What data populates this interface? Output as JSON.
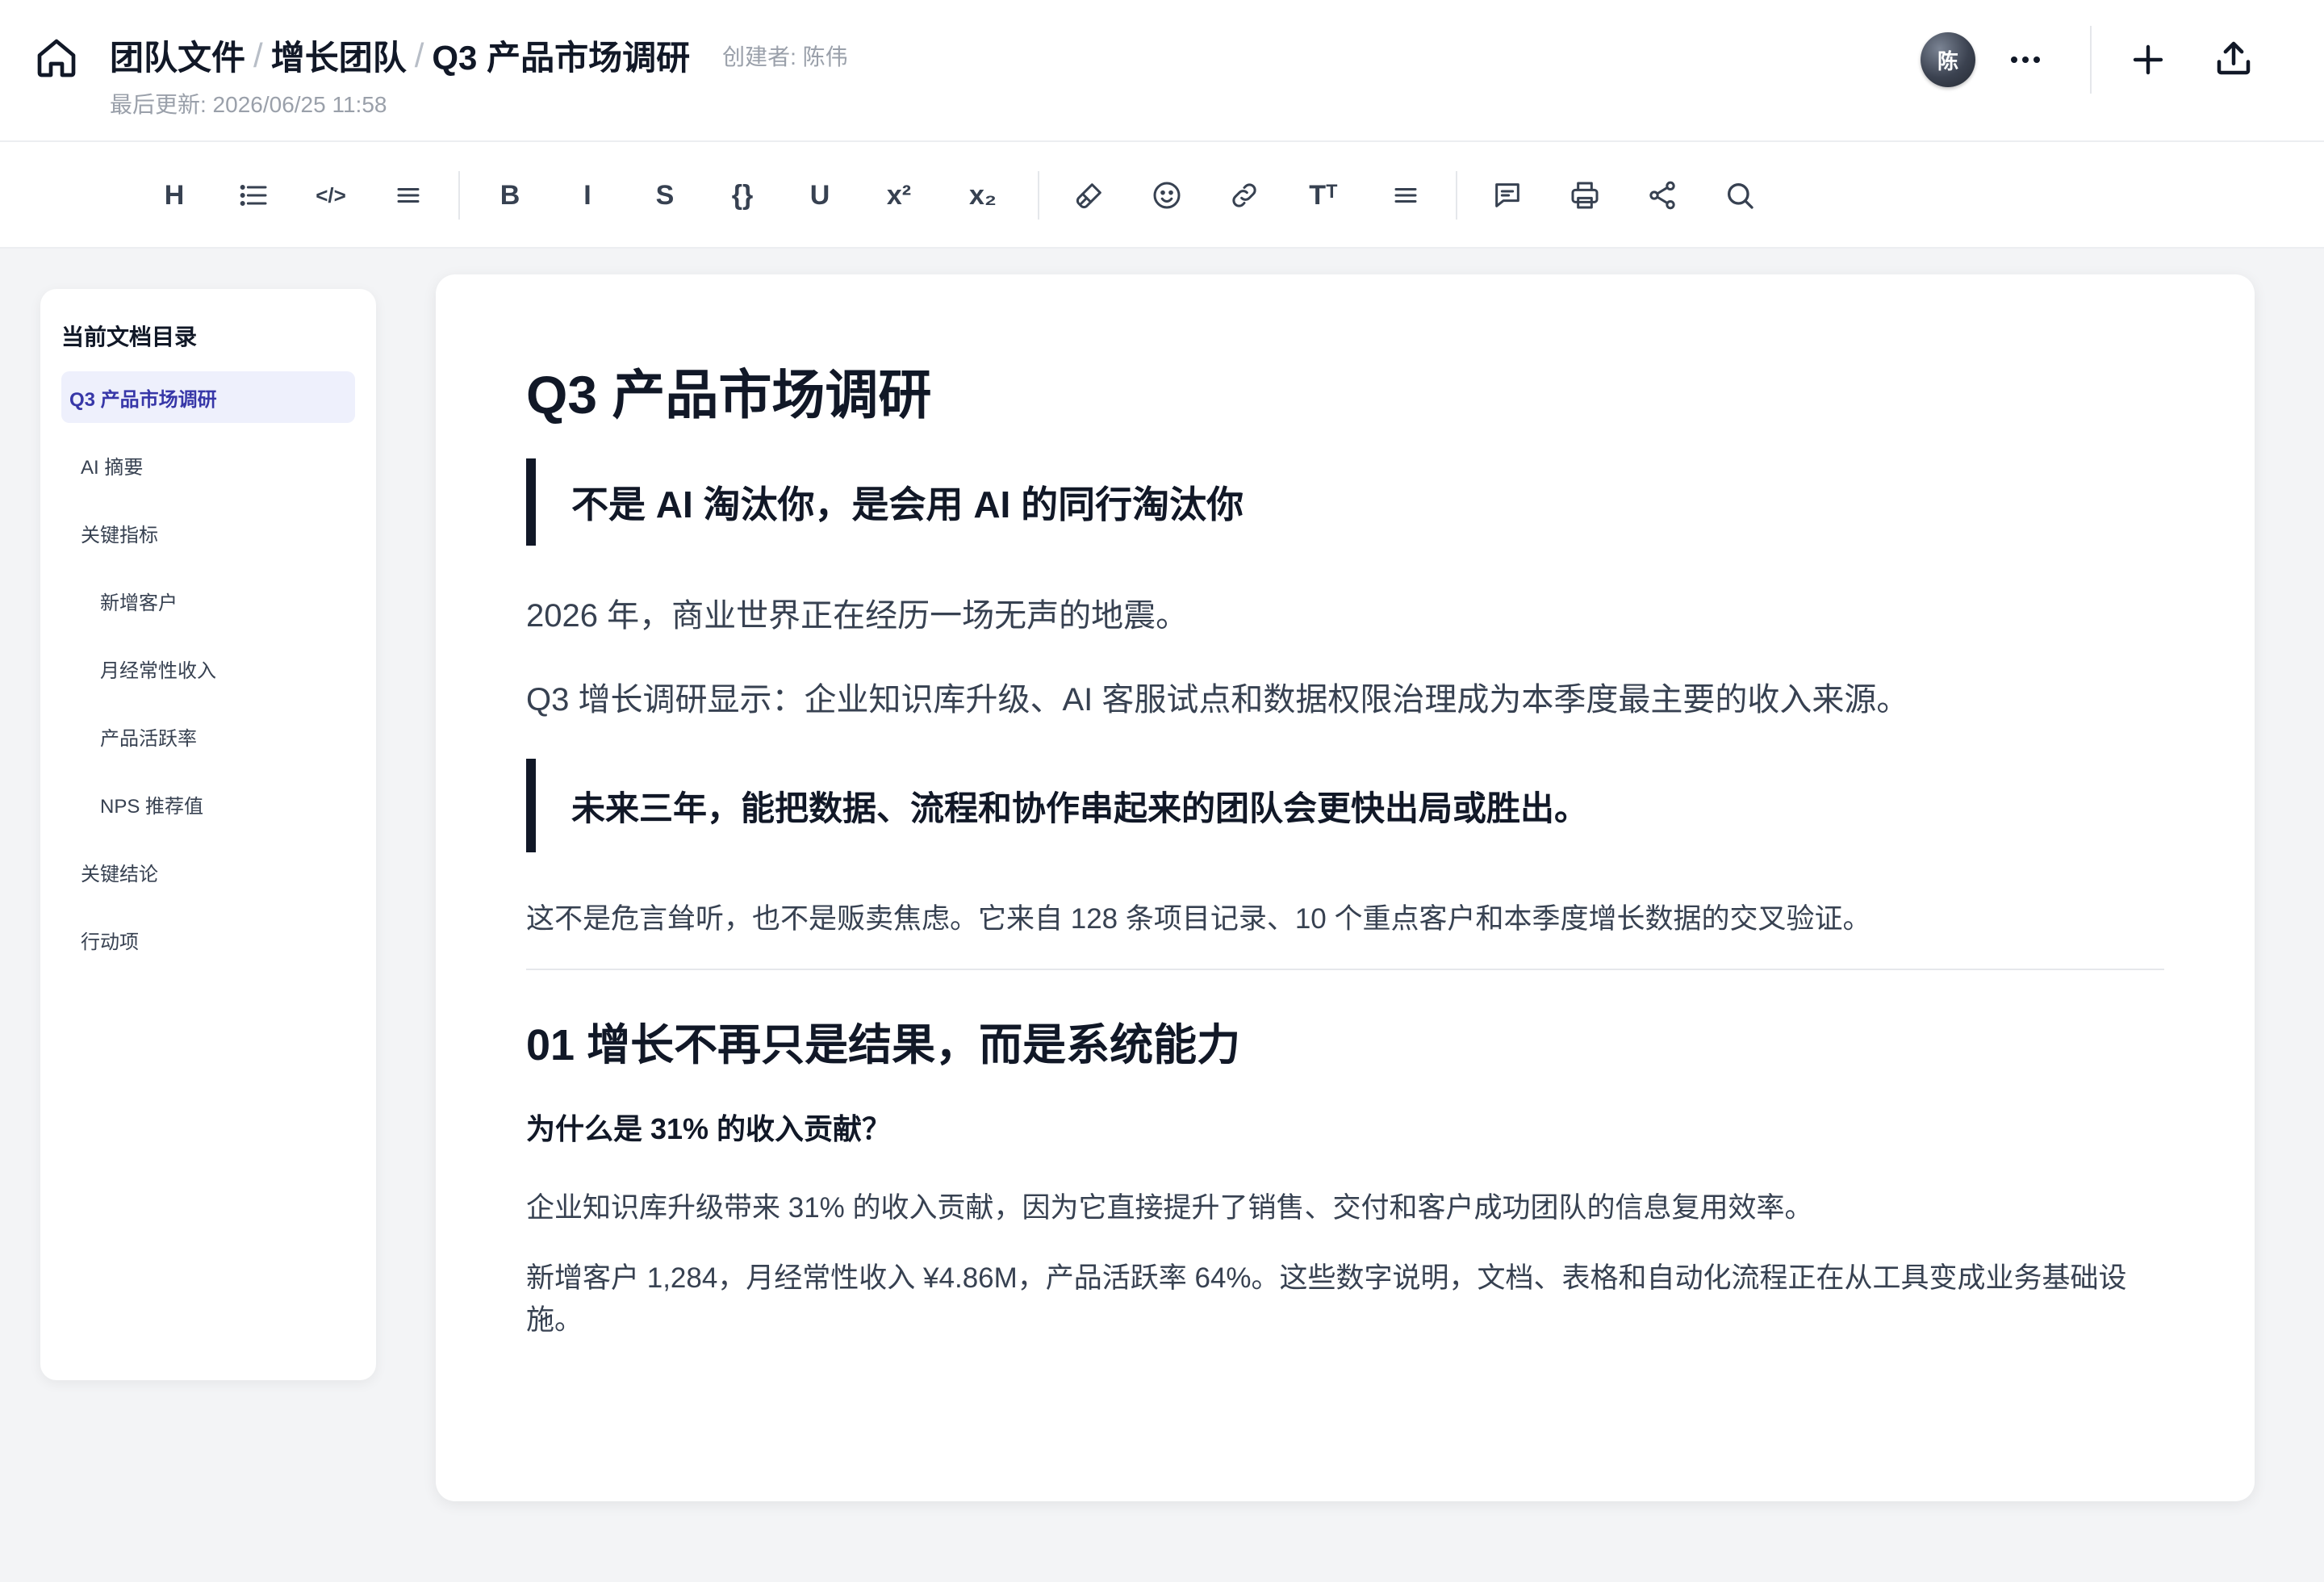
{
  "header": {
    "breadcrumb": [
      "团队文件",
      "增长团队",
      "Q3 产品市场调研"
    ],
    "separator": "/",
    "creator": "创建者: 陈伟",
    "last_updated": "最后更新: 2026/06/25 11:58",
    "avatar_initial": "陈",
    "icons": [
      "home-icon",
      "more-icon",
      "plus-icon",
      "upload-icon"
    ]
  },
  "toolbar": {
    "heading": "H",
    "code": "</>",
    "bold": "B",
    "italic": "I",
    "strike": "S",
    "braces": "{}",
    "underline": "U",
    "superscript": "x²",
    "subscript": "x₂",
    "text_size": "Tᵀ",
    "icons": [
      "heading-icon",
      "bullet-list-icon",
      "code-icon",
      "align-icon",
      "bold-icon",
      "italic-icon",
      "strikethrough-icon",
      "code-block-icon",
      "underline-icon",
      "superscript-icon",
      "subscript-icon",
      "format-painter-icon",
      "emoji-icon",
      "link-icon",
      "text-size-icon",
      "more-align-icon",
      "comment-icon",
      "print-icon",
      "share-icon",
      "search-icon"
    ]
  },
  "sidebar": {
    "title": "当前文档目录",
    "items": [
      {
        "label": "Q3 产品市场调研",
        "level": 0,
        "active": true
      },
      {
        "label": "AI 摘要",
        "level": 1
      },
      {
        "label": "关键指标",
        "level": 1
      },
      {
        "label": "新增客户",
        "level": 2
      },
      {
        "label": "月经常性收入",
        "level": 2
      },
      {
        "label": "产品活跃率",
        "level": 2
      },
      {
        "label": "NPS 推荐值",
        "level": 2
      },
      {
        "label": "关键结论",
        "level": 1
      },
      {
        "label": "行动项",
        "level": 1
      }
    ]
  },
  "document": {
    "title": "Q3 产品市场调研",
    "quote1": "不是 AI 淘汰你，是会用 AI 的同行淘汰你",
    "para1": "2026 年，商业世界正在经历一场无声的地震。",
    "para2": "Q3 增长调研显示：企业知识库升级、AI 客服试点和数据权限治理成为本季度最主要的收入来源。",
    "quote2": "未来三年，能把数据、流程和协作串起来的团队会更快出局或胜出。",
    "para3": "这不是危言耸听，也不是贩卖焦虑。它来自 128 条项目记录、10 个重点客户和本季度增长数据的交叉验证。",
    "section_heading": "01 增长不再只是结果，而是系统能力",
    "sub_heading": "为什么是 31% 的收入贡献？",
    "para4": "企业知识库升级带来 31% 的收入贡献，因为它直接提升了销售、交付和客户成功团队的信息复用效率。",
    "para5": "新增客户 1,284，月经常性收入 ¥4.86M，产品活跃率 64%。这些数字说明，文档、表格和自动化流程正在从工具变成业务基础设施。"
  },
  "colors": {
    "accent": "#3737a8",
    "accent_bg": "#eef0fc",
    "text": "#111827",
    "muted": "#9aa0aa",
    "background": "#f3f4f6"
  }
}
